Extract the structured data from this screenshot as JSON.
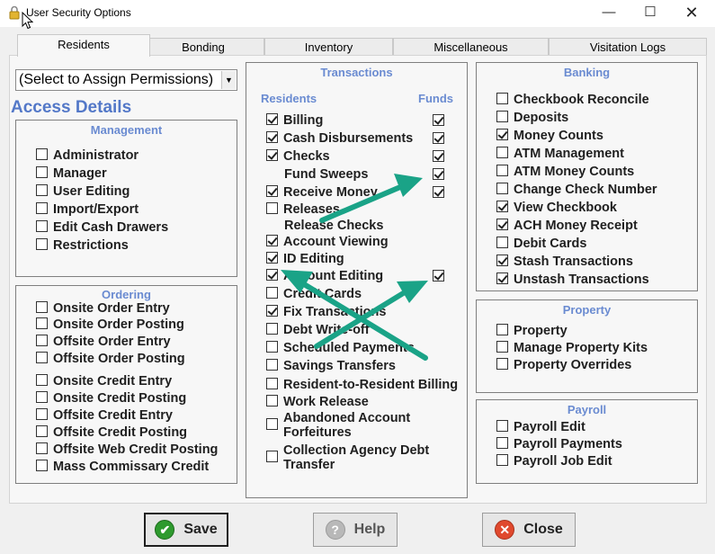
{
  "window": {
    "title": "User Security Options",
    "minimize": "—",
    "maximize": "☐",
    "close": "✕"
  },
  "tabs": [
    "Residents",
    "Bonding",
    "Inventory",
    "Miscellaneous",
    "Visitation Logs"
  ],
  "permission_select": {
    "value": "(Select to Assign Permissions)"
  },
  "access_details_title": "Access Details",
  "management": {
    "title": "Management",
    "items": [
      {
        "label": "Administrator",
        "checked": false
      },
      {
        "label": "Manager",
        "checked": false
      },
      {
        "label": "User Editing",
        "checked": false
      },
      {
        "label": "Import/Export",
        "checked": false
      },
      {
        "label": "Edit Cash Drawers",
        "checked": false
      },
      {
        "label": "Restrictions",
        "checked": false
      }
    ]
  },
  "ordering": {
    "title": "Ordering",
    "items": [
      {
        "label": "Onsite Order Entry",
        "checked": false
      },
      {
        "label": "Onsite Order Posting",
        "checked": false
      },
      {
        "label": "Offsite Order Entry",
        "checked": false
      },
      {
        "label": "Offsite Order Posting",
        "checked": false
      },
      {
        "label": "Onsite Credit Entry",
        "checked": false
      },
      {
        "label": "Onsite Credit Posting",
        "checked": false
      },
      {
        "label": "Offsite Credit Entry",
        "checked": false
      },
      {
        "label": "Offsite Credit Posting",
        "checked": false
      },
      {
        "label": "Offsite Web Credit Posting",
        "checked": false
      },
      {
        "label": "Mass Commissary Credit",
        "checked": false
      }
    ]
  },
  "transactions": {
    "title": "Transactions",
    "residents_header": "Residents",
    "funds_header": "Funds",
    "items": [
      {
        "label": "Billing",
        "checked": true,
        "fund": true
      },
      {
        "label": "Cash Disbursements",
        "checked": true,
        "fund": true
      },
      {
        "label": "Checks",
        "checked": true,
        "fund": true
      },
      {
        "label": "Fund Sweeps",
        "checked": null,
        "fund": true
      },
      {
        "label": "Receive Money",
        "checked": true,
        "fund": true
      },
      {
        "label": "Releases",
        "checked": false,
        "fund": null
      },
      {
        "label": "Release Checks",
        "checked": null,
        "fund": null
      },
      {
        "label": "Account Viewing",
        "checked": true,
        "fund": null
      },
      {
        "label": "ID Editing",
        "checked": true,
        "fund": null
      },
      {
        "label": "Account Editing",
        "checked": true,
        "fund": true
      },
      {
        "label": "Credit Cards",
        "checked": false,
        "fund": null
      },
      {
        "label": "Fix Transactions",
        "checked": true,
        "fund": null
      },
      {
        "label": "Debt Write-off",
        "checked": false,
        "fund": null
      },
      {
        "label": "Scheduled Payments",
        "checked": false,
        "fund": null
      },
      {
        "label": "Savings Transfers",
        "checked": false,
        "fund": null
      },
      {
        "label": "Resident-to-Resident Billing",
        "checked": false,
        "fund": null
      },
      {
        "label": "Work Release",
        "checked": false,
        "fund": null
      },
      {
        "label": "Abandoned Account Forfeitures",
        "checked": false,
        "fund": null
      },
      {
        "label": "Collection Agency Debt Transfer",
        "checked": false,
        "fund": null
      }
    ]
  },
  "banking": {
    "title": "Banking",
    "items": [
      {
        "label": "Checkbook Reconcile",
        "checked": false
      },
      {
        "label": "Deposits",
        "checked": false
      },
      {
        "label": "Money Counts",
        "checked": true
      },
      {
        "label": "ATM Management",
        "checked": false
      },
      {
        "label": "ATM Money Counts",
        "checked": false
      },
      {
        "label": "Change Check Number",
        "checked": false
      },
      {
        "label": "View Checkbook",
        "checked": true
      },
      {
        "label": "ACH Money Receipt",
        "checked": true
      },
      {
        "label": "Debit Cards",
        "checked": false
      },
      {
        "label": "Stash Transactions",
        "checked": true
      },
      {
        "label": "Unstash Transactions",
        "checked": true
      }
    ]
  },
  "property": {
    "title": "Property",
    "items": [
      {
        "label": "Property",
        "checked": false
      },
      {
        "label": "Manage Property Kits",
        "checked": false
      },
      {
        "label": "Property Overrides",
        "checked": false
      }
    ]
  },
  "payroll": {
    "title": "Payroll",
    "items": [
      {
        "label": "Payroll Edit",
        "checked": false
      },
      {
        "label": "Payroll Payments",
        "checked": false
      },
      {
        "label": "Payroll Job Edit",
        "checked": false
      }
    ]
  },
  "buttons": {
    "save": "Save",
    "help": "Help",
    "close": "Close"
  },
  "colors": {
    "accent_blue": "#5378c8",
    "arrow_teal": "#1aa387",
    "save_green": "#2e9a2e",
    "close_red": "#e0492e"
  }
}
